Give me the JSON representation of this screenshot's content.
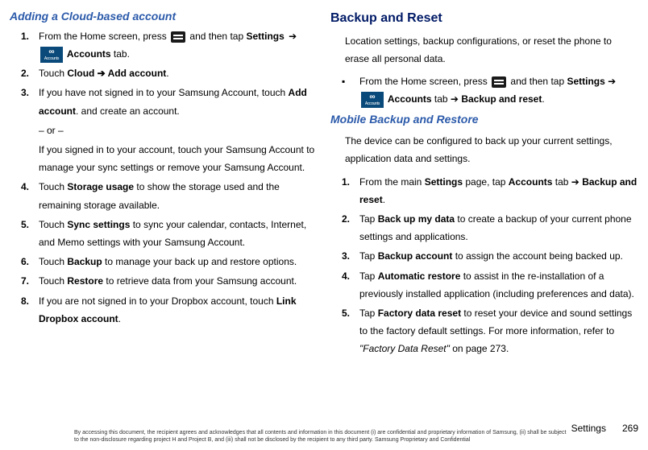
{
  "left": {
    "heading": "Adding a Cloud-based account",
    "item1_a": "From the Home screen, press ",
    "item1_b": " and then tap ",
    "item1_settings": "Settings",
    "item1_arrow": " ➔ ",
    "item1_accounts": " Accounts",
    "item1_tab": " tab.",
    "item2_a": "Touch ",
    "item2_cloud": "Cloud ➔ Add account",
    "item2_b": ".",
    "item3_a": "If you have not signed in to your Samsung Account, touch ",
    "item3_add": "Add account",
    "item3_b": ". and create an account.",
    "item3_or": "– or –",
    "item3_alt": "If you signed in to your account, touch your Samsung Account to manage your sync settings or remove your Samsung Account.",
    "item4_a": "Touch ",
    "item4_storage": "Storage usage",
    "item4_b": " to show the storage used and the remaining storage available.",
    "item5_a": "Touch ",
    "item5_sync": "Sync settings",
    "item5_b": " to sync your calendar, contacts, Internet, and Memo settings with your Samsung Account.",
    "item6_a": "Touch ",
    "item6_backup": "Backup",
    "item6_b": " to manage your back up and restore options.",
    "item7_a": "Touch ",
    "item7_restore": "Restore",
    "item7_b": " to retrieve data from your Samsung account.",
    "item8_a": "If you are not signed in to your Dropbox account, touch ",
    "item8_link": "Link Dropbox account",
    "item8_b": "."
  },
  "right": {
    "heading": "Backup and Reset",
    "intro": "Location settings, backup configurations, or reset the phone to erase all personal data.",
    "bullet_a": "From the Home screen, press ",
    "bullet_b": " and then tap ",
    "bullet_settings": "Settings",
    "bullet_arrow1": " ➔ ",
    "bullet_accounts": " Accounts",
    "bullet_tab": " tab ",
    "bullet_arrow2": "➔ ",
    "bullet_backup": "Backup and reset",
    "bullet_c": ".",
    "mobile_heading": "Mobile Backup and Restore",
    "mobile_intro": "The device can be configured to back up your current settings, application data and settings.",
    "m1_a": "From the main ",
    "m1_settings": "Settings",
    "m1_b": " page, tap ",
    "m1_accounts": "Accounts",
    "m1_c": " tab ➔ ",
    "m1_backup": "Backup and reset",
    "m1_d": ".",
    "m2_a": "Tap ",
    "m2_backup": "Back up my data",
    "m2_b": " to create a backup of your current phone settings and applications.",
    "m3_a": "Tap ",
    "m3_account": "Backup account",
    "m3_b": " to assign the account being backed up.",
    "m4_a": "Tap ",
    "m4_auto": "Automatic restore",
    "m4_b": " to assist in the re-installation of a previously installed application (including preferences and data).",
    "m5_a": "Tap ",
    "m5_factory": "Factory data reset",
    "m5_b": " to reset your device and sound settings to the factory default settings. For more information, refer to ",
    "m5_quote": "\"Factory Data Reset\"",
    "m5_c": " on page 273."
  },
  "footer": {
    "legal": "By accessing this document, the recipient agrees and acknowledges that all contents and information in this document (i) are confidential and proprietary information of Samsung, (ii) shall be subject to the non-disclosure regarding project H and Project B, and (iii) shall not be disclosed by the recipient to any third party. Samsung Proprietary and Confidential",
    "section": "Settings",
    "page": "269"
  }
}
